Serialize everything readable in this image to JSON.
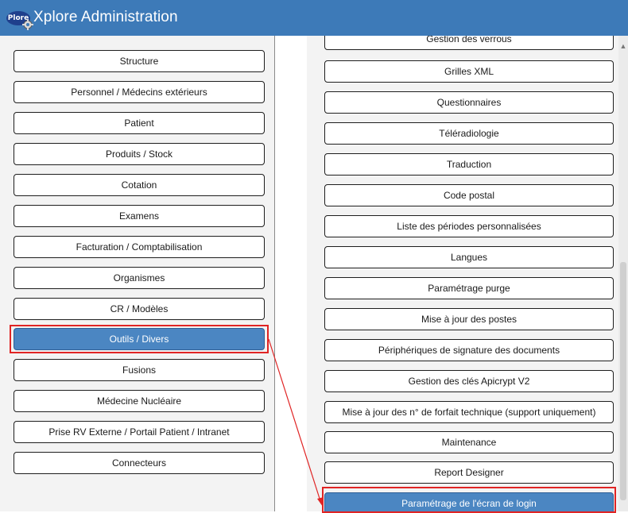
{
  "header": {
    "logo_text": "Plore",
    "title": "Xplore Administration",
    "accent_color": "#3d7ab8"
  },
  "left_menu": {
    "items": [
      {
        "label": "Structure"
      },
      {
        "label": "Personnel / Médecins extérieurs"
      },
      {
        "label": "Patient"
      },
      {
        "label": "Produits / Stock"
      },
      {
        "label": "Cotation"
      },
      {
        "label": "Examens"
      },
      {
        "label": "Facturation / Comptabilisation"
      },
      {
        "label": "Organismes"
      },
      {
        "label": "CR / Modèles"
      },
      {
        "label": "Outils / Divers",
        "selected": true
      },
      {
        "label": "Fusions"
      },
      {
        "label": "Médecine Nucléaire"
      },
      {
        "label": "Prise RV Externe / Portail Patient / Intranet"
      },
      {
        "label": "Connecteurs"
      }
    ]
  },
  "right_menu": {
    "items": [
      {
        "label": "Gestion des verrous"
      },
      {
        "label": "Grilles XML"
      },
      {
        "label": "Questionnaires"
      },
      {
        "label": "Téléradiologie"
      },
      {
        "label": "Traduction"
      },
      {
        "label": "Code postal"
      },
      {
        "label": "Liste des périodes personnalisées"
      },
      {
        "label": "Langues"
      },
      {
        "label": "Paramétrage purge"
      },
      {
        "label": "Mise à jour des postes"
      },
      {
        "label": "Périphériques de signature des documents"
      },
      {
        "label": "Gestion des clés Apicrypt V2"
      },
      {
        "label": "Mise à jour des n° de forfait technique (support uniquement)"
      },
      {
        "label": "Maintenance"
      },
      {
        "label": "Report Designer"
      },
      {
        "label": "Paramétrage de l'écran de login",
        "selected": true
      }
    ]
  },
  "colors": {
    "selected_button": "#4b86c2",
    "annotation": "#e02424"
  }
}
